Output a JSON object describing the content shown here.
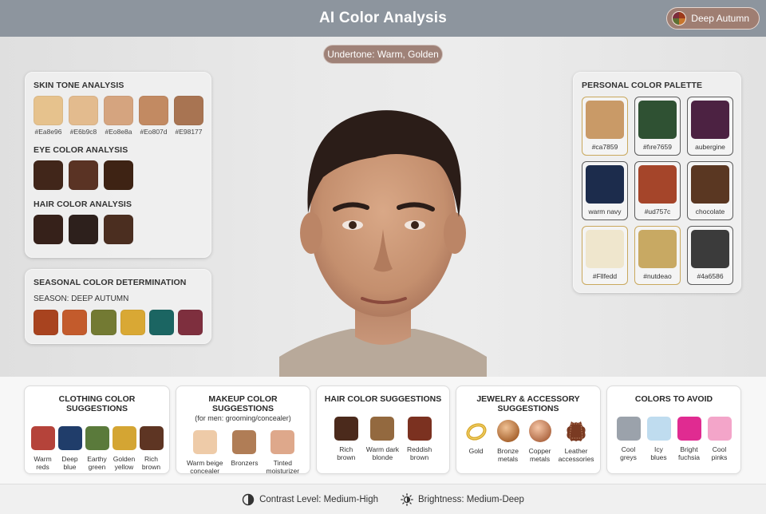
{
  "header": {
    "title": "AI Color Analysis",
    "season_chip": "Deep Autumn"
  },
  "undertone": "Undertone: Warm, Golden",
  "skin": {
    "title": "SKIN TONE ANALYSIS",
    "swatches": [
      {
        "code": "#Ea8e96",
        "color": "#e6c28d"
      },
      {
        "code": "#E6b9c8",
        "color": "#e3bb8e"
      },
      {
        "code": "#Eo8e8a",
        "color": "#d5a47f"
      },
      {
        "code": "#Eo807d",
        "color": "#c28a62"
      },
      {
        "code": "#E98177",
        "color": "#a87452"
      }
    ]
  },
  "eye": {
    "title": "EYE COLOR ANALYSIS",
    "colors": [
      "#41261a",
      "#5a3324",
      "#3e2314"
    ]
  },
  "hair": {
    "title": "HAIR COLOR ANALYSIS",
    "colors": [
      "#36211a",
      "#2d201c",
      "#4b2e20"
    ]
  },
  "season": {
    "title": "SEASONAL COLOR DETERMINATION",
    "label": "SEASON: DEEP AUTUMN",
    "colors": [
      "#a8431f",
      "#c35b2c",
      "#737a33",
      "#d9a834",
      "#1b6562",
      "#7e2f3e"
    ]
  },
  "palette": {
    "title": "PERSONAL COLOR PALETTE",
    "cells": [
      {
        "label": "#ca7859",
        "color": "#c99a67",
        "frame": "gold"
      },
      {
        "label": "#fıre7659",
        "color": "#2f5133",
        "frame": "dark"
      },
      {
        "label": "aubergine",
        "color": "#4c2242",
        "frame": "dark"
      },
      {
        "label": "warm navy",
        "color": "#1c2c4c",
        "frame": "dark"
      },
      {
        "label": "#ud757c",
        "color": "#a5452a",
        "frame": "dark"
      },
      {
        "label": "chocolate",
        "color": "#5a3722",
        "frame": "dark"
      },
      {
        "label": "#Fllfedd",
        "color": "#efe6cd",
        "frame": "gold"
      },
      {
        "label": "#nutdeao",
        "color": "#c8a963",
        "frame": "gold"
      },
      {
        "label": "#4a6586",
        "color": "#3b3b3b",
        "frame": "dark"
      }
    ]
  },
  "clothing": {
    "title": "CLOTHING COLOR SUGGESTIONS",
    "items": [
      {
        "label": "Warm\nreds",
        "color": "#b5433a"
      },
      {
        "label": "Deep\nblue",
        "color": "#203d6a"
      },
      {
        "label": "Earthy\ngreen",
        "color": "#5a7a3b"
      },
      {
        "label": "Golden\nyellow",
        "color": "#d4a533"
      },
      {
        "label": "Rich\nbrown",
        "color": "#5e3523"
      }
    ]
  },
  "makeup": {
    "title": "MAKEUP COLOR SUGGESTIONS",
    "subtitle": "(for men: grooming/concealer)",
    "items": [
      {
        "label": "Warm beige\nconcealer",
        "color": "#eecba8"
      },
      {
        "label": "Bronzers",
        "color": "#b07d56"
      },
      {
        "label": "Tinted\nmoisturizer",
        "color": "#dea88b"
      }
    ]
  },
  "hair_suggest": {
    "title": "HAIR COLOR SUGGESTIONS",
    "items": [
      {
        "label": "Rich\nbrown",
        "color": "#4b2a1c"
      },
      {
        "label": "Warm dark\nblonde",
        "color": "#93693f"
      },
      {
        "label": "Reddish\nbrown",
        "color": "#7b3120"
      }
    ]
  },
  "jewelry": {
    "title": "JEWELRY & ACCESSORY\nSUGGESTIONS",
    "items": [
      {
        "label": "Gold",
        "icon": "gold-ring-icon"
      },
      {
        "label": "Bronze\nmetals",
        "icon": "bronze-icon"
      },
      {
        "label": "Copper\nmetals",
        "icon": "copper-icon"
      },
      {
        "label": "Leather\naccessories",
        "icon": "leather-icon"
      }
    ]
  },
  "avoid": {
    "title": "COLORS TO AVOID",
    "items": [
      {
        "label": "Cool\ngreys",
        "color": "#9ba2ab"
      },
      {
        "label": "Icy\nblues",
        "color": "#bfdcef"
      },
      {
        "label": "Bright\nfuchsia",
        "color": "#e02b91"
      },
      {
        "label": "Cool\npinks",
        "color": "#f3a5c9"
      }
    ]
  },
  "footer": {
    "contrast": "Contrast Level: Medium-High",
    "brightness": "Brightness: Medium-Deep"
  }
}
